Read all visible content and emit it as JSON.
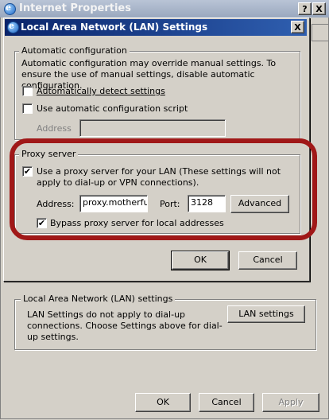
{
  "outer_window": {
    "title": "Internet Properties",
    "help_button": "?",
    "close_button": "X"
  },
  "dialog": {
    "title": "Local Area Network (LAN) Settings",
    "close_button": "X",
    "auto_config": {
      "group_label": "Automatic configuration",
      "description": "Automatic configuration may override manual settings.  To ensure the use of manual settings, disable automatic configuration.",
      "auto_detect_label": "Automatically detect settings",
      "auto_detect_checked": false,
      "script_label": "Use automatic configuration script",
      "script_checked": false,
      "address_label": "Address",
      "address_value": ""
    },
    "proxy": {
      "group_label": "Proxy server",
      "use_proxy_label": "Use a proxy server for your LAN (These settings will not apply to dial-up or VPN connections).",
      "use_proxy_checked": true,
      "address_label": "Address:",
      "address_value": "proxy.motherfu(",
      "port_label": "Port:",
      "port_value": "3128",
      "advanced_button": "Advanced",
      "bypass_label": "Bypass proxy server for local addresses",
      "bypass_checked": true
    },
    "ok_button": "OK",
    "cancel_button": "Cancel",
    "highlight_color": "#a01818"
  },
  "lan_section": {
    "title": "Local Area Network (LAN) settings",
    "description": "LAN Settings do not apply to dial-up connections. Choose Settings above for dial-up settings.",
    "button": "LAN settings"
  },
  "footer": {
    "ok_button": "OK",
    "cancel_button": "Cancel",
    "apply_button": "Apply"
  },
  "icons": {
    "window": "ie-globe-icon",
    "check": "✔"
  }
}
